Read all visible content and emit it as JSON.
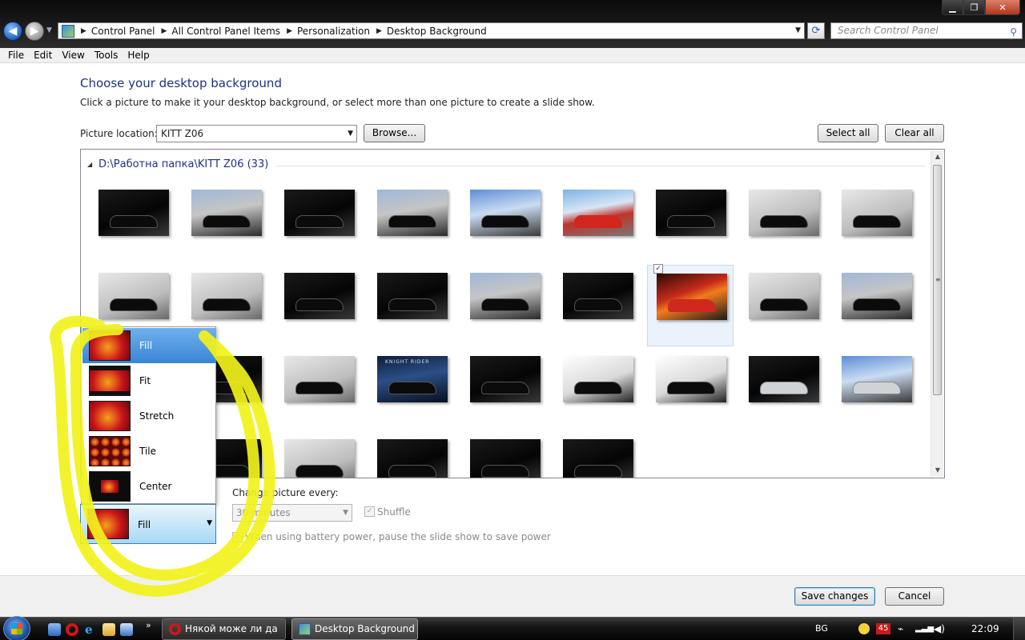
{
  "window": {
    "address": {
      "crumbs": [
        "Control Panel",
        "All Control Panel Items",
        "Personalization",
        "Desktop Background"
      ]
    },
    "search_placeholder": "Search Control Panel",
    "menu": [
      "File",
      "Edit",
      "View",
      "Tools",
      "Help"
    ]
  },
  "page": {
    "title": "Choose your desktop background",
    "subtitle": "Click a picture to make it your desktop background, or select more than one picture to create a slide show.",
    "location_label": "Picture location:",
    "location_value": "KITT Z06",
    "browse_label": "Browse...",
    "select_all_label": "Select all",
    "clear_all_label": "Clear all",
    "group_title": "D:\\Работна папка\\KITT Z06 (33)",
    "thumbnails": [
      {
        "style": "dark",
        "car": "black"
      },
      {
        "style": "street",
        "car": "black"
      },
      {
        "style": "dark",
        "car": "black"
      },
      {
        "style": "street",
        "car": "black"
      },
      {
        "style": "sky",
        "car": "black"
      },
      {
        "style": "red",
        "car": "redc"
      },
      {
        "style": "dark",
        "car": "black"
      },
      {
        "style": "grey",
        "car": "black"
      },
      {
        "style": "grey",
        "car": "black"
      },
      {
        "style": "grey",
        "car": "black"
      },
      {
        "style": "grey",
        "car": "black"
      },
      {
        "style": "dark",
        "car": "black"
      },
      {
        "style": "dark",
        "car": "black"
      },
      {
        "style": "street",
        "car": "black"
      },
      {
        "style": "dark",
        "car": "black"
      },
      {
        "style": "fire",
        "car": "redc",
        "selected": true
      },
      {
        "style": "grey",
        "car": "black"
      },
      {
        "style": "street",
        "car": "black"
      },
      {
        "style": "dark",
        "car": "black"
      },
      {
        "style": "dark",
        "car": "black"
      },
      {
        "style": "grey",
        "car": "black"
      },
      {
        "style": "kr",
        "car": "black",
        "caption": "KNIGHT RIDER"
      },
      {
        "style": "dark",
        "car": "black"
      },
      {
        "style": "white",
        "car": "black"
      },
      {
        "style": "white",
        "car": "black"
      },
      {
        "style": "dark",
        "car": "silver"
      },
      {
        "style": "sky",
        "car": "silver"
      },
      {
        "style": "grey",
        "car": "black"
      },
      {
        "style": "dark",
        "car": "black"
      },
      {
        "style": "grey",
        "car": "black"
      },
      {
        "style": "dark",
        "car": "black"
      },
      {
        "style": "dark",
        "car": "black"
      },
      {
        "style": "dark",
        "car": "black"
      }
    ],
    "positions": [
      "Fill",
      "Fit",
      "Stretch",
      "Tile",
      "Center"
    ],
    "position_value": "Fill",
    "slideshow": {
      "label": "Change picture every:",
      "interval": "30 minutes",
      "shuffle_label": "Shuffle",
      "battery_label": "When using battery power, pause the slide show to save power"
    },
    "save_label": "Save changes",
    "cancel_label": "Cancel"
  },
  "taskbar": {
    "tasks": [
      "Някой може ли да ...",
      "Desktop Background"
    ],
    "language": "BG",
    "badge_count": "45",
    "clock": "22:09"
  }
}
